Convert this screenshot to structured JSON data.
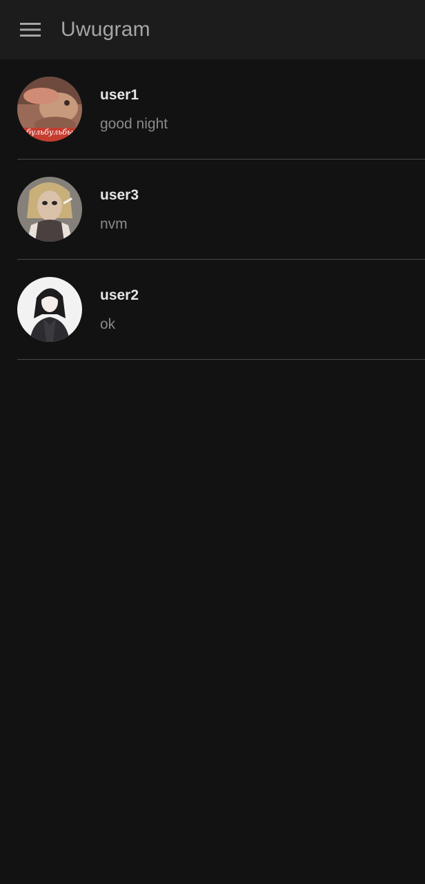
{
  "app_bar": {
    "title": "Uwugram",
    "menu_icon": "hamburger-menu-icon"
  },
  "colors": {
    "background": "#121212",
    "app_bar": "#1c1c1c",
    "title": "#a6a6a6",
    "name": "#e6e6e6",
    "preview": "#8a8a8a",
    "divider": "#4a4a4a"
  },
  "chats": [
    {
      "name": "user1",
      "preview": "good night",
      "avatar_caption": "бульбульбы"
    },
    {
      "name": "user3",
      "preview": "nvm"
    },
    {
      "name": "user2",
      "preview": "ok"
    }
  ]
}
